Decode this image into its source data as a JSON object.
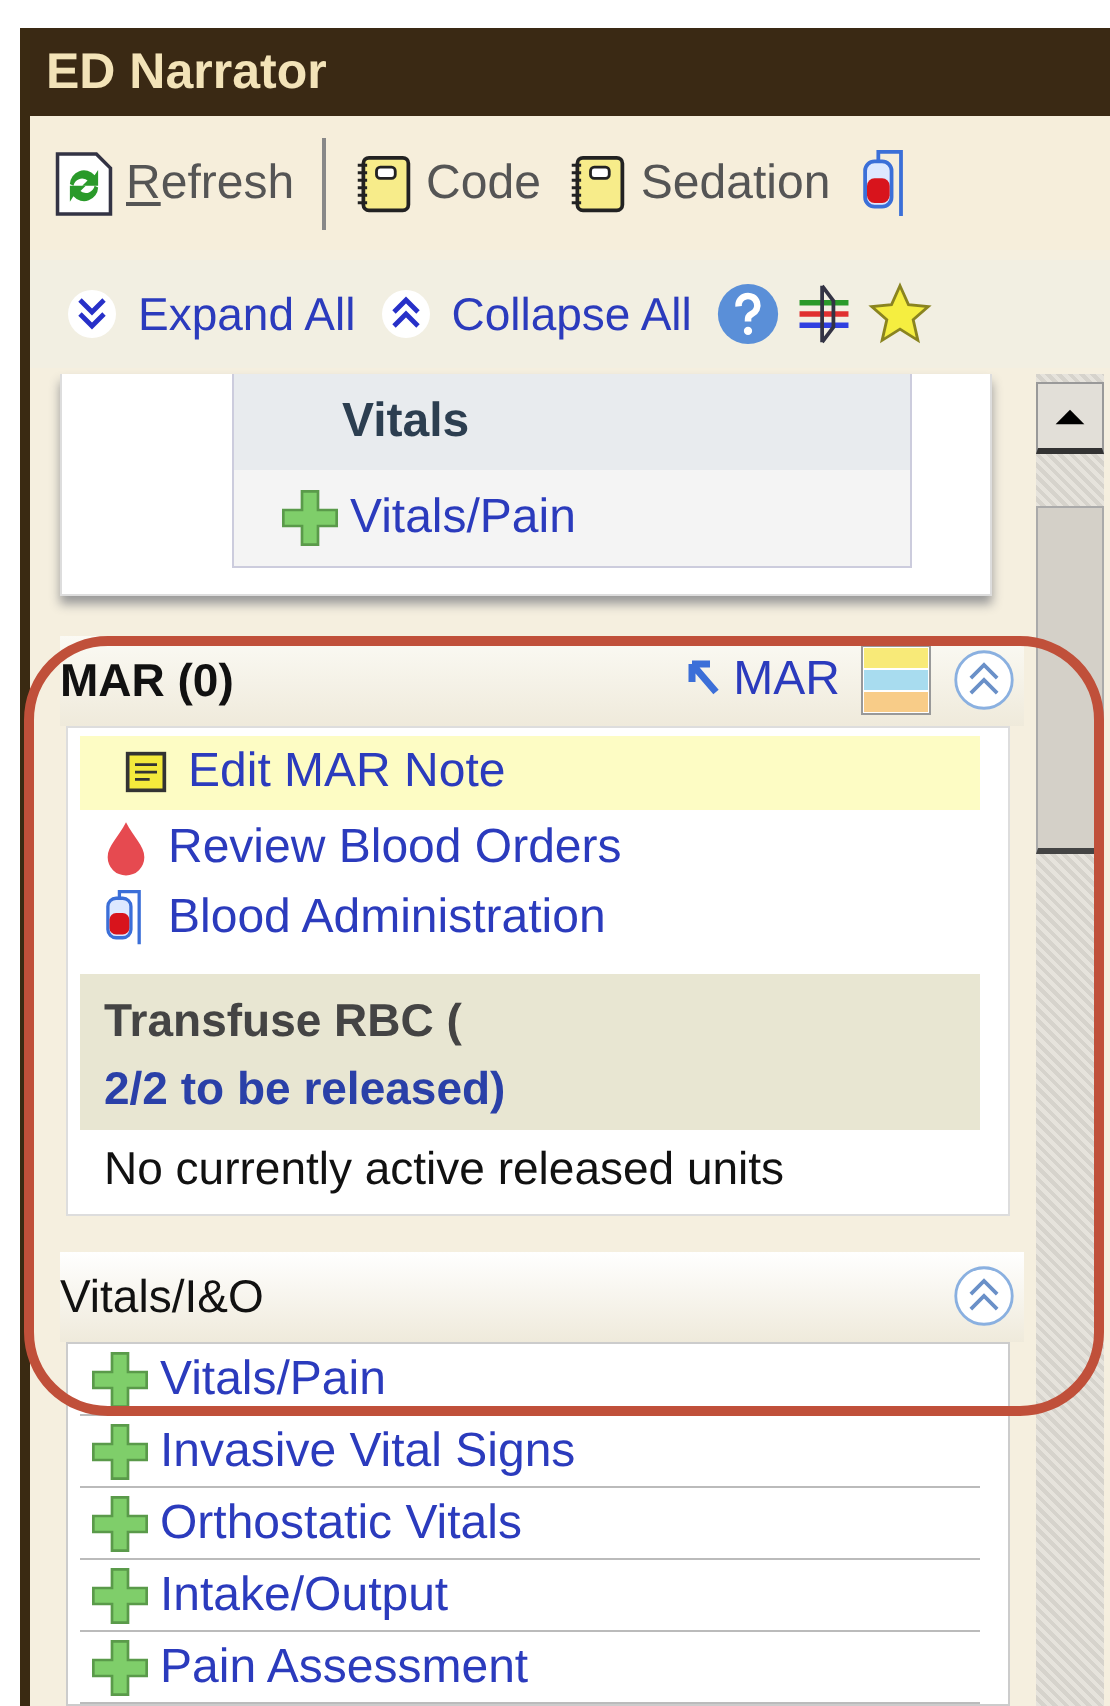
{
  "window": {
    "title": "ED Narrator"
  },
  "toolbar": [
    {
      "label": "Refresh",
      "kind": "refresh"
    },
    {
      "label": "Code",
      "kind": "notebook"
    },
    {
      "label": "Sedation",
      "kind": "notebook"
    },
    {
      "kind": "blood-bag"
    }
  ],
  "actions": [
    {
      "label": "Expand All",
      "kind": "expand"
    },
    {
      "label": "Collapse All",
      "kind": "collapse"
    }
  ],
  "vitals_card": {
    "title": "Vitals",
    "items": [
      "Vitals/Pain"
    ]
  },
  "mar": {
    "title": "MAR (0)",
    "link": "MAR",
    "items": [
      {
        "label": "Edit MAR Note",
        "kind": "note",
        "selected": true
      },
      {
        "label": "Review Blood Orders",
        "kind": "drop",
        "selected": false
      },
      {
        "label": "Blood Administration",
        "kind": "bag",
        "selected": false
      }
    ],
    "order": {
      "title": "Transfuse RBC (",
      "status": "2/2 to be released)"
    },
    "note": "No currently active released units"
  },
  "vitals_io": {
    "title": "Vitals/I&O",
    "items": [
      "Vitals/Pain",
      "Invasive Vital Signs",
      "Orthostatic Vitals",
      "Intake/Output",
      "Pain Assessment"
    ]
  }
}
